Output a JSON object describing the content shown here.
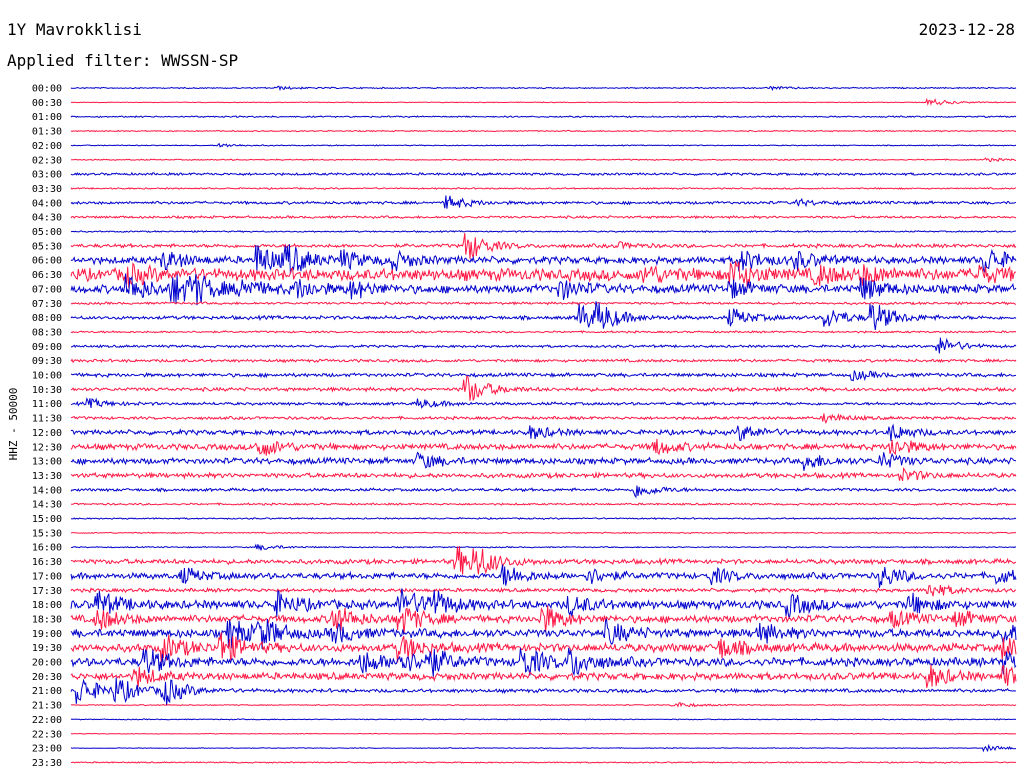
{
  "header": {
    "station": "1Y Mavrokklisi",
    "date": "2023-12-28",
    "filter": "Applied filter: WWSSN-SP"
  },
  "chart_data": {
    "type": "line",
    "ylabel": "HHZ - 50000",
    "colors": {
      "even_rows": "#0000cc",
      "odd_rows": "#ff1744"
    },
    "rows": [
      {
        "label": "00:00",
        "activity": 0.05,
        "events": [
          [
            0.22,
            0.1
          ],
          [
            0.74,
            0.1
          ]
        ]
      },
      {
        "label": "00:30",
        "activity": 0.03,
        "events": [
          [
            0.91,
            0.25
          ]
        ]
      },
      {
        "label": "01:00",
        "activity": 0.06,
        "events": []
      },
      {
        "label": "01:30",
        "activity": 0.05,
        "events": []
      },
      {
        "label": "02:00",
        "activity": 0.04,
        "events": [
          [
            0.16,
            0.12
          ]
        ]
      },
      {
        "label": "02:30",
        "activity": 0.05,
        "events": [
          [
            0.97,
            0.1
          ]
        ]
      },
      {
        "label": "03:00",
        "activity": 0.1,
        "events": []
      },
      {
        "label": "03:30",
        "activity": 0.06,
        "events": []
      },
      {
        "label": "04:00",
        "activity": 0.12,
        "events": [
          [
            0.4,
            0.45
          ],
          [
            0.77,
            0.2
          ]
        ]
      },
      {
        "label": "04:30",
        "activity": 0.1,
        "events": []
      },
      {
        "label": "05:00",
        "activity": 0.06,
        "events": []
      },
      {
        "label": "05:30",
        "activity": 0.15,
        "events": [
          [
            0.42,
            1.0
          ],
          [
            0.58,
            0.2
          ]
        ]
      },
      {
        "label": "06:00",
        "activity": 0.3,
        "events": [
          [
            0.1,
            0.6
          ],
          [
            0.2,
            1.0
          ],
          [
            0.23,
            0.9
          ],
          [
            0.29,
            0.5
          ],
          [
            0.34,
            0.6
          ],
          [
            0.71,
            0.7
          ],
          [
            0.77,
            0.5
          ],
          [
            0.97,
            0.8
          ]
        ]
      },
      {
        "label": "06:30",
        "activity": 0.5,
        "events": [
          [
            0.06,
            0.6
          ],
          [
            0.61,
            0.5
          ],
          [
            0.7,
            1.0
          ],
          [
            0.79,
            0.6
          ],
          [
            0.84,
            0.5
          ],
          [
            0.96,
            0.5
          ]
        ]
      },
      {
        "label": "07:00",
        "activity": 0.35,
        "events": [
          [
            0.06,
            1.0
          ],
          [
            0.11,
            1.0
          ],
          [
            0.13,
            0.8
          ],
          [
            0.18,
            0.6
          ],
          [
            0.24,
            0.6
          ],
          [
            0.3,
            0.5
          ],
          [
            0.52,
            0.6
          ],
          [
            0.7,
            0.5
          ],
          [
            0.84,
            0.7
          ]
        ]
      },
      {
        "label": "07:30",
        "activity": 0.1,
        "events": []
      },
      {
        "label": "08:00",
        "activity": 0.15,
        "events": [
          [
            0.54,
            1.0
          ],
          [
            0.56,
            0.7
          ],
          [
            0.7,
            0.6
          ],
          [
            0.8,
            0.7
          ],
          [
            0.85,
            1.0
          ]
        ]
      },
      {
        "label": "08:30",
        "activity": 0.08,
        "events": []
      },
      {
        "label": "09:00",
        "activity": 0.1,
        "events": [
          [
            0.92,
            0.6
          ]
        ]
      },
      {
        "label": "09:30",
        "activity": 0.12,
        "events": []
      },
      {
        "label": "10:00",
        "activity": 0.15,
        "events": [
          [
            0.83,
            0.3
          ]
        ]
      },
      {
        "label": "10:30",
        "activity": 0.15,
        "events": [
          [
            0.42,
            1.0
          ]
        ]
      },
      {
        "label": "11:00",
        "activity": 0.12,
        "events": [
          [
            0.02,
            0.3
          ],
          [
            0.37,
            0.3
          ]
        ]
      },
      {
        "label": "11:30",
        "activity": 0.12,
        "events": [
          [
            0.8,
            0.3
          ]
        ]
      },
      {
        "label": "12:00",
        "activity": 0.2,
        "events": [
          [
            0.49,
            0.4
          ],
          [
            0.71,
            0.5
          ],
          [
            0.87,
            0.5
          ]
        ]
      },
      {
        "label": "12:30",
        "activity": 0.25,
        "events": [
          [
            0.2,
            0.7
          ],
          [
            0.62,
            0.5
          ],
          [
            0.87,
            0.6
          ]
        ]
      },
      {
        "label": "13:00",
        "activity": 0.25,
        "events": [
          [
            0.37,
            0.5
          ],
          [
            0.78,
            0.5
          ],
          [
            0.86,
            0.5
          ]
        ]
      },
      {
        "label": "13:30",
        "activity": 0.2,
        "events": [
          [
            0.88,
            0.4
          ]
        ]
      },
      {
        "label": "14:00",
        "activity": 0.12,
        "events": [
          [
            0.6,
            0.5
          ]
        ]
      },
      {
        "label": "14:30",
        "activity": 0.08,
        "events": []
      },
      {
        "label": "15:00",
        "activity": 0.06,
        "events": []
      },
      {
        "label": "15:30",
        "activity": 0.05,
        "events": []
      },
      {
        "label": "16:00",
        "activity": 0.05,
        "events": [
          [
            0.2,
            0.2
          ]
        ]
      },
      {
        "label": "16:30",
        "activity": 0.2,
        "events": [
          [
            0.41,
            1.0
          ],
          [
            0.43,
            0.8
          ]
        ]
      },
      {
        "label": "17:00",
        "activity": 0.25,
        "events": [
          [
            0.12,
            0.5
          ],
          [
            0.46,
            0.7
          ],
          [
            0.55,
            0.5
          ],
          [
            0.68,
            0.5
          ],
          [
            0.86,
            0.7
          ],
          [
            0.98,
            0.5
          ]
        ]
      },
      {
        "label": "17:30",
        "activity": 0.15,
        "events": [
          [
            0.91,
            0.5
          ]
        ]
      },
      {
        "label": "18:00",
        "activity": 0.35,
        "events": [
          [
            0.03,
            0.8
          ],
          [
            0.22,
            0.7
          ],
          [
            0.35,
            1.0
          ],
          [
            0.38,
            0.9
          ],
          [
            0.53,
            0.6
          ],
          [
            0.76,
            0.7
          ],
          [
            0.89,
            0.6
          ]
        ]
      },
      {
        "label": "18:30",
        "activity": 0.3,
        "events": [
          [
            0.03,
            0.7
          ],
          [
            0.28,
            0.9
          ],
          [
            0.35,
            1.0
          ],
          [
            0.5,
            0.9
          ],
          [
            0.87,
            0.5
          ],
          [
            0.94,
            0.5
          ]
        ]
      },
      {
        "label": "19:00",
        "activity": 0.35,
        "events": [
          [
            0.17,
            0.9
          ],
          [
            0.2,
            1.0
          ],
          [
            0.28,
            0.6
          ],
          [
            0.57,
            0.7
          ],
          [
            0.73,
            0.6
          ],
          [
            0.99,
            0.7
          ]
        ]
      },
      {
        "label": "19:30",
        "activity": 0.35,
        "events": [
          [
            0.1,
            0.8
          ],
          [
            0.16,
            1.0
          ],
          [
            0.35,
            0.8
          ],
          [
            0.69,
            0.6
          ],
          [
            0.99,
            0.8
          ]
        ]
      },
      {
        "label": "20:00",
        "activity": 0.35,
        "events": [
          [
            0.08,
            0.9
          ],
          [
            0.31,
            0.7
          ],
          [
            0.35,
            0.7
          ],
          [
            0.38,
            0.8
          ],
          [
            0.48,
            1.0
          ],
          [
            0.53,
            0.9
          ],
          [
            0.99,
            0.7
          ]
        ]
      },
      {
        "label": "20:30",
        "activity": 0.3,
        "events": [
          [
            0.07,
            0.6
          ],
          [
            0.91,
            0.7
          ],
          [
            0.99,
            0.6
          ]
        ]
      },
      {
        "label": "21:00",
        "activity": 0.15,
        "events": [
          [
            0.01,
            1.0
          ],
          [
            0.05,
            0.8
          ],
          [
            0.1,
            0.9
          ]
        ]
      },
      {
        "label": "21:30",
        "activity": 0.04,
        "events": [
          [
            0.64,
            0.2
          ]
        ]
      },
      {
        "label": "22:00",
        "activity": 0.04,
        "events": []
      },
      {
        "label": "22:30",
        "activity": 0.03,
        "events": []
      },
      {
        "label": "23:00",
        "activity": 0.03,
        "events": [
          [
            0.97,
            0.2
          ]
        ]
      },
      {
        "label": "23:30",
        "activity": 0.05,
        "events": []
      }
    ]
  }
}
